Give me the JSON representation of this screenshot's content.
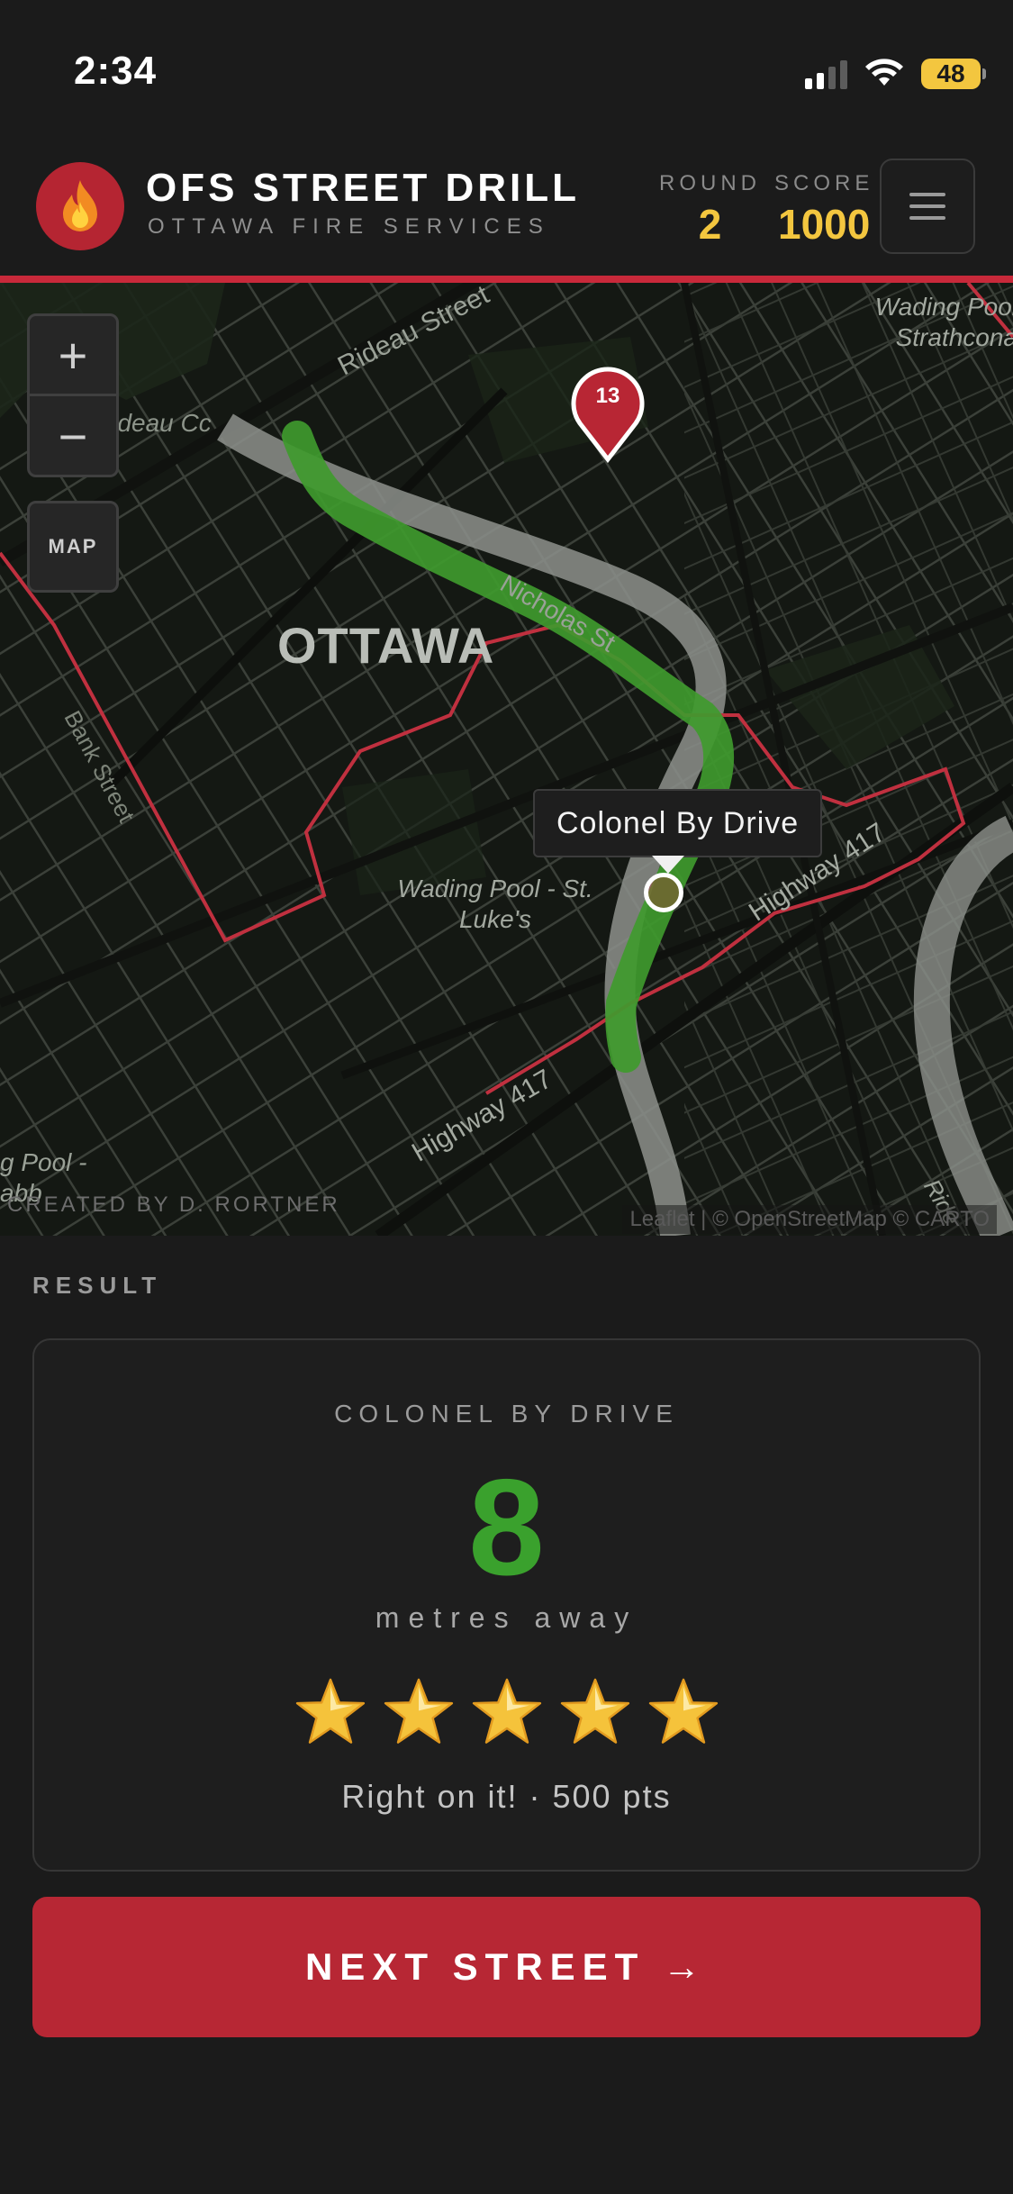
{
  "status_bar": {
    "time": "2:34",
    "battery": "48"
  },
  "app": {
    "title": "OFS STREET DRILL",
    "subtitle": "OTTAWA  FIRE  SERVICES",
    "round_label": "ROUND",
    "round_value": "2",
    "score_label": "SCORE",
    "score_value": "1000"
  },
  "map": {
    "zoom_in": "+",
    "zoom_out": "−",
    "layer_toggle": "MAP",
    "tooltip": "Colonel By Drive",
    "pin_number": "13",
    "labels": {
      "rideau_street": "Rideau Street",
      "rideau_canal": "Rideau Cc",
      "ottawa": "OTTAWA",
      "nicholas": "Nicholas St",
      "bank_street": "Bank Street",
      "wading_pool_st_lukes_1": "Wading Pool - St.",
      "wading_pool_st_lukes_2": "Luke's",
      "highway_417_east": "Highway 417",
      "highway_417_west": "Highway 417",
      "wading_pool_strathcona_1": "Wading Pool",
      "wading_pool_strathcona_2": "Strathcona",
      "pool_left_1": "g Pool -",
      "pool_left_2": "abb",
      "rideau_right": "Ride"
    },
    "credit": "CREATED BY D. RORTNER",
    "attribution": "Leaflet | © OpenStreetMap © CARTO"
  },
  "result": {
    "heading": "RESULT",
    "street": "COLONEL BY DRIVE",
    "distance": "8",
    "unit": "metres away",
    "rating": 5,
    "rating_max": 5,
    "message": "Right on it! · 500 pts"
  },
  "next_button": "NEXT STREET →",
  "colors": {
    "brand_red": "#b72734",
    "score_yellow": "#f3c63f",
    "distance_green": "#3aa12d",
    "route_green": "#3f9a2e"
  }
}
